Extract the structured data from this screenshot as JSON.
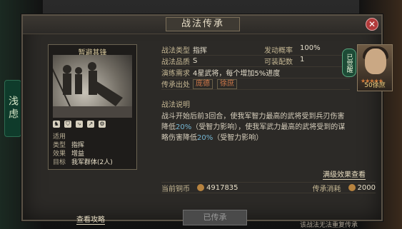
{
  "window": {
    "title": "战法传承",
    "close_icon": "close-icon"
  },
  "card": {
    "name": "暂避其锋",
    "info": [
      {
        "label": "适用",
        "value": ""
      },
      {
        "label": "类型",
        "value": "指挥"
      },
      {
        "label": "效果",
        "value": "增益"
      },
      {
        "label": "目标",
        "value": "我军群体(2人)"
      }
    ],
    "icons": [
      "horse-icon",
      "shield-icon",
      "bow-icon",
      "spear-icon",
      "chariot-icon"
    ]
  },
  "details": {
    "type_label": "战法类型",
    "type_value": "指挥",
    "rate_label": "发动概率",
    "rate_value": "100%",
    "quality_label": "战法品质",
    "quality_value": "S",
    "slots_label": "可装配数",
    "slots_value": "1",
    "require_label": "演练需求",
    "require_value": "4星武将，每个增加5%进度",
    "origin_label": "传承出处",
    "origin_tags": [
      "庞德",
      "徐庶"
    ]
  },
  "general": {
    "badge": "已觉醒",
    "level": "50徐庶"
  },
  "description": {
    "title": "战法说明",
    "text1": "战斗开始后前3回合，使我军智力最高的武将受到兵刃伤害",
    "text2": "降低",
    "hl1": "20%",
    "text3": "（受智力影响），使我军武力最高的武将受到的谋",
    "text4": "略伤害降低",
    "hl2": "20%",
    "text5": "（受智力影响）"
  },
  "links": {
    "full_effect": "满级效果查看",
    "strategy": "查看攻略"
  },
  "currency": {
    "copper_label": "当前铜币",
    "copper_value": "4917835",
    "cost_label": "传承消耗",
    "cost_value": "2000"
  },
  "action": {
    "button": "已传承",
    "note": "该战法无法重复传承"
  },
  "colors": {
    "highlight": "#75b7d4",
    "tag": "#d27a4b",
    "close": "#b23a3a"
  }
}
